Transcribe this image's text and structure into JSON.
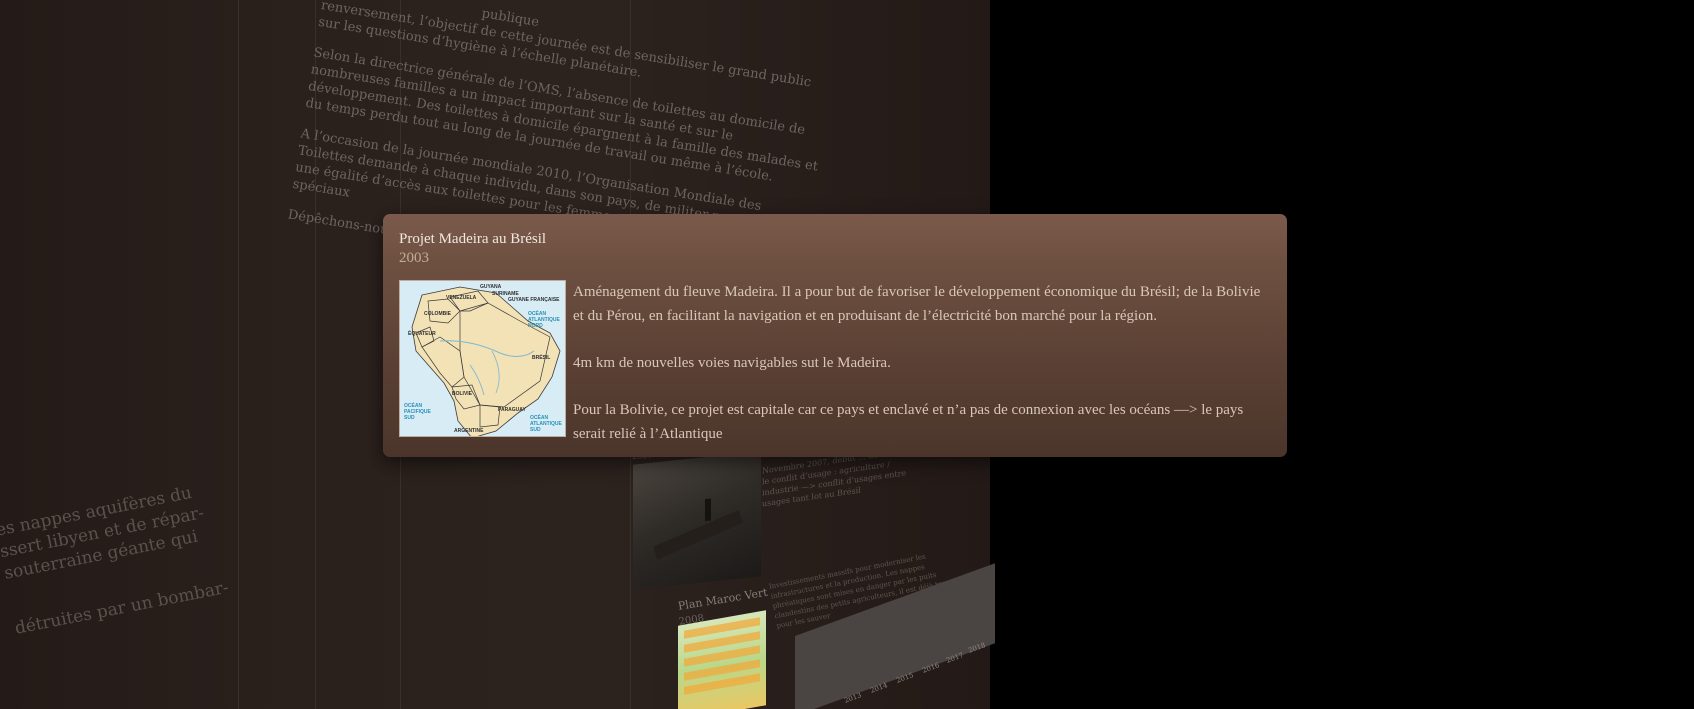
{
  "article": {
    "fragment_top": "publique",
    "fragment_line": "renversement, l’objectif de cette journée est de sensibiliser le grand public sur les questions d’hygiène à l’échelle planétaire.",
    "paragraphs": [
      "Selon la directrice générale de l’OMS, l’absence de toilettes au domicile de nombreuses familles a un impact important sur la santé et sur le développement. Des toilettes à domicile épargnent à la famille des malades et du temps perdu tout au long de la journée de travail ou même à l’école.",
      "A l’occasion de la journée mondiale 2010, l’Organisation Mondiale des Toilettes demande à chaque individu, dans son pays, de militer pour obtenir une égalité d’accès aux toilettes pour les femmes et des aménagements spéciaux",
      "Dépêchons-nous, cela presse."
    ]
  },
  "left_fragment": {
    "lines_1": "es nappes aquifères du ssert libyen et de répar- souterraine géante qui",
    "lines_2": "détruites par un bombar-"
  },
  "timeline_items": {
    "photo_year": "2007",
    "photo_caption": "Novembre 2007, début ... dénoncer le conflit d’usage : agriculture / industrie —> conflit d’usages entre usages tant lot au Brésil",
    "plan_title": "Plan Maroc Vert",
    "plan_year": "2008",
    "plan_caption": "Investissements massifs pour moderniser les infrastructures et la production. Les nappes phréatiques sont mises en danger par les puits clandestins des petits agriculteurs, il est déjà trop tard pour les sauver"
  },
  "timeline_axis": {
    "years": [
      "2013",
      "2014",
      "2015",
      "2016",
      "2017",
      "2018"
    ]
  },
  "popup": {
    "title": "Projet Madeira au Brésil",
    "year": "2003",
    "paragraphs": [
      "Aménagement du fleuve Madeira. Il a pour but de favoriser le développement économique du Brésil; de la Bolivie et du Pérou, en facilitant la navigation et en produisant de l’électricité bon marché pour la région.",
      "4m km de nouvelles voies navigables sut le Madeira.",
      "Pour la Bolivie, ce projet est capitale car ce pays et enclavé et n’a pas de connexion avec les océans —> le pays serait relié à l’Atlantique"
    ],
    "map": {
      "labels": {
        "guyana": "GUYANA",
        "suriname": "SURINAME",
        "guyane": "GUYANE FRANÇAISE",
        "venezuela": "VENEZUELA",
        "colombie": "COLOMBIE",
        "equateur": "ÉQUATEUR",
        "bresil": "BRÉSIL",
        "bolivie": "BOLIVIE",
        "paraguay": "PARAGUAY",
        "argentine": "ARGENTINE",
        "ocean_atl_nord": "OCÉAN ATLANTIQUE NORD",
        "ocean_pacifique_sud": "OCÉAN PACIFIQUE SUD",
        "ocean_atl_sud": "OCÉAN ATLANTIQUE SUD"
      }
    }
  },
  "colors": {
    "background": "#000000",
    "panel": "#2a201c",
    "popup_top": "#7b5a4b",
    "popup_bottom": "#4b352b",
    "popup_title": "#f2e8e0",
    "popup_text": "#d9c7b9"
  }
}
